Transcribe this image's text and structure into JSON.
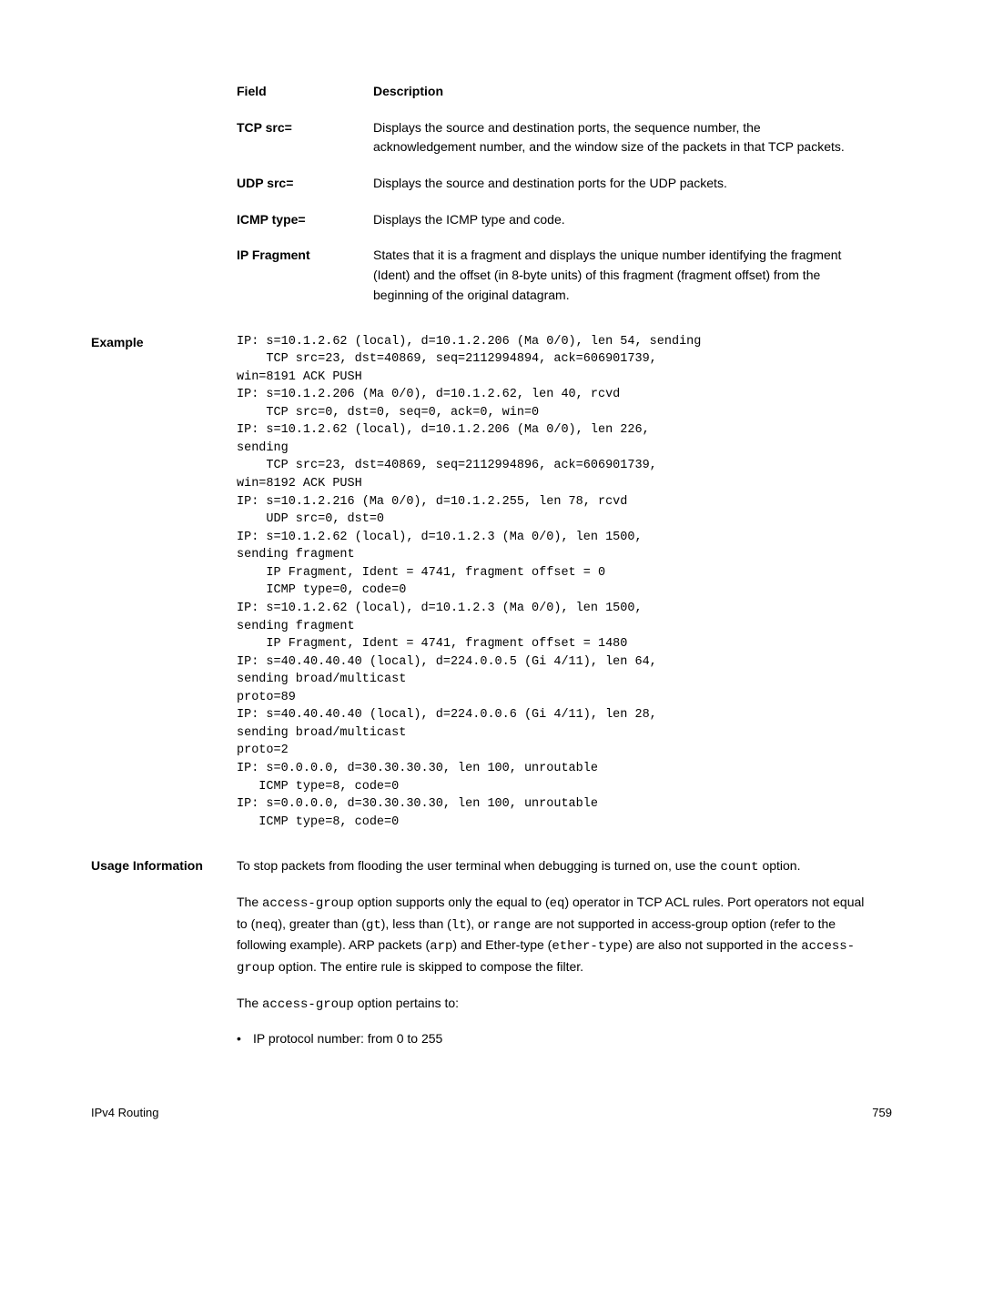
{
  "fields": [
    {
      "name": "Field",
      "desc": "Description"
    },
    {
      "name": "TCP src=",
      "desc": "Displays the source and destination ports, the sequence number, the acknowledgement number, and the window size of the packets in that TCP packets."
    },
    {
      "name": "UDP src=",
      "desc": "Displays the source and destination ports for the UDP packets."
    },
    {
      "name": "ICMP type=",
      "desc": "Displays the ICMP type and code."
    },
    {
      "name": "IP Fragment",
      "desc": "States that it is a fragment and displays the unique number identifying the fragment (Ident) and the offset (in 8-byte units) of this fragment (fragment offset) from the beginning of the original datagram."
    }
  ],
  "example": {
    "label": "Example",
    "code": "IP: s=10.1.2.62 (local), d=10.1.2.206 (Ma 0/0), len 54, sending\n    TCP src=23, dst=40869, seq=2112994894, ack=606901739,\nwin=8191 ACK PUSH\nIP: s=10.1.2.206 (Ma 0/0), d=10.1.2.62, len 40, rcvd\n    TCP src=0, dst=0, seq=0, ack=0, win=0\nIP: s=10.1.2.62 (local), d=10.1.2.206 (Ma 0/0), len 226,\nsending\n    TCP src=23, dst=40869, seq=2112994896, ack=606901739,\nwin=8192 ACK PUSH\nIP: s=10.1.2.216 (Ma 0/0), d=10.1.2.255, len 78, rcvd\n    UDP src=0, dst=0\nIP: s=10.1.2.62 (local), d=10.1.2.3 (Ma 0/0), len 1500,\nsending fragment\n    IP Fragment, Ident = 4741, fragment offset = 0\n    ICMP type=0, code=0\nIP: s=10.1.2.62 (local), d=10.1.2.3 (Ma 0/0), len 1500,\nsending fragment\n    IP Fragment, Ident = 4741, fragment offset = 1480\nIP: s=40.40.40.40 (local), d=224.0.0.5 (Gi 4/11), len 64,\nsending broad/multicast\nproto=89\nIP: s=40.40.40.40 (local), d=224.0.0.6 (Gi 4/11), len 28,\nsending broad/multicast\nproto=2\nIP: s=0.0.0.0, d=30.30.30.30, len 100, unroutable\n   ICMP type=8, code=0\nIP: s=0.0.0.0, d=30.30.30.30, len 100, unroutable\n   ICMP type=8, code=0"
  },
  "usage": {
    "label": "Usage Information",
    "p1_a": "To stop packets from flooding the user terminal when debugging is turned on, use the ",
    "p1_b": "count",
    "p1_c": " option.",
    "p2_a": "The ",
    "p2_b": "access-group",
    "p2_c": " option supports only the equal to (",
    "p2_d": "eq",
    "p2_e": ") operator in TCP ACL rules. Port operators not equal to (",
    "p2_f": "neq",
    "p2_g": "), greater than (",
    "p2_h": "gt",
    "p2_i": "), less than (",
    "p2_j": "lt",
    "p2_k": "), or ",
    "p2_l": "range",
    "p2_m": " are not supported in access-group option (refer to the following example). ARP packets (",
    "p2_n": "arp",
    "p2_o": ") and Ether-type (",
    "p2_p": "ether-type",
    "p2_q": ") are also not supported in the ",
    "p2_r": "access-group",
    "p2_s": " option. The entire rule is skipped to compose the filter.",
    "p3_a": "The ",
    "p3_b": "access-group",
    "p3_c": " option pertains to:",
    "bullet1": "IP protocol number: from 0 to 255"
  },
  "footer": {
    "left": "IPv4 Routing",
    "right": "759"
  }
}
